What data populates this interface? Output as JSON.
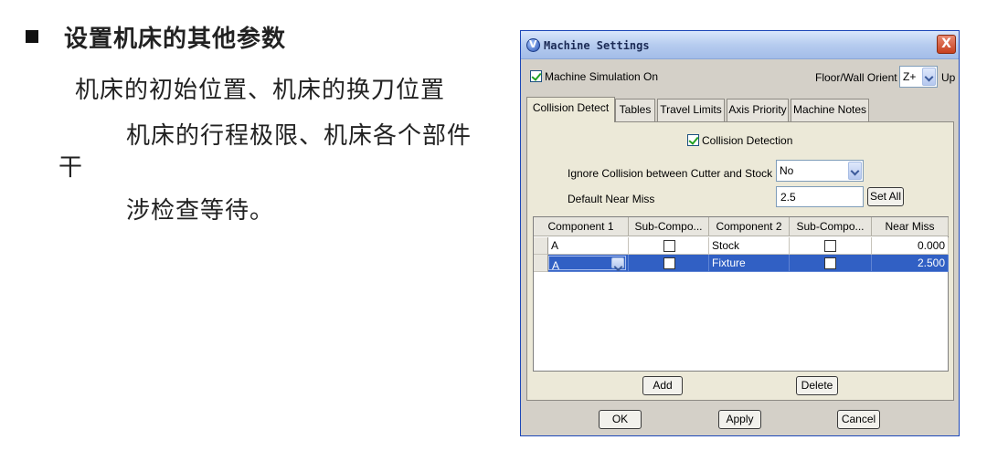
{
  "slide": {
    "heading": "设置机床的其他参数",
    "line1": "机床的初始位置、机床的换刀位置",
    "line2": "机床的行程极限、机床各个部件",
    "line3": "干",
    "line4": "涉检查等待。"
  },
  "dialog": {
    "title": "Machine Settings",
    "close_label": "X",
    "machine_simulation_label": "Machine Simulation On",
    "machine_simulation_checked": true,
    "floor_wall_label": "Floor/Wall Orient",
    "orient_value": "Z+",
    "up_label": "Up",
    "tabs": [
      {
        "label": "Collision Detect",
        "active": true
      },
      {
        "label": "Tables",
        "active": false
      },
      {
        "label": "Travel Limits",
        "active": false
      },
      {
        "label": "Axis Priority",
        "active": false
      },
      {
        "label": "Machine Notes",
        "active": false
      }
    ],
    "collision": {
      "detection_label": "Collision Detection",
      "detection_checked": true,
      "ignore_label": "Ignore Collision between Cutter and Stock",
      "ignore_value": "No",
      "near_miss_label": "Default Near Miss",
      "near_miss_value": "2.5",
      "set_all_label": "Set All",
      "columns": [
        "Component 1",
        "Sub-Compo...",
        "Component 2",
        "Sub-Compo...",
        "Near Miss"
      ],
      "rows": [
        {
          "component1": "A",
          "sub1": false,
          "component2": "Stock",
          "sub2": false,
          "near_miss": "0.000",
          "selected": false
        },
        {
          "component1": "A",
          "sub1": false,
          "component2": "Fixture",
          "sub2": false,
          "near_miss": "2.500",
          "selected": true
        }
      ],
      "add_label": "Add",
      "delete_label": "Delete"
    },
    "ok_label": "OK",
    "apply_label": "Apply",
    "cancel_label": "Cancel"
  }
}
